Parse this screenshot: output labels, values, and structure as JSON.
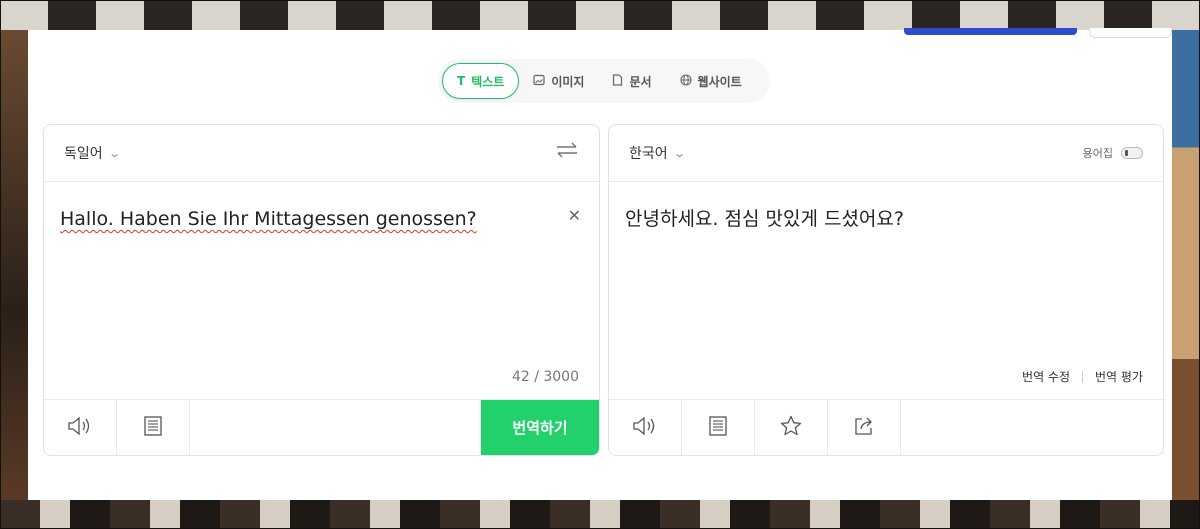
{
  "tabs": [
    {
      "label": "텍스트",
      "icon": "text-icon",
      "active": true
    },
    {
      "label": "이미지",
      "icon": "image-icon",
      "active": false
    },
    {
      "label": "문서",
      "icon": "document-icon",
      "active": false
    },
    {
      "label": "웹사이트",
      "icon": "globe-icon",
      "active": false
    }
  ],
  "source": {
    "language": "독일어",
    "text": "Hallo. Haben Sie Ihr Mittagessen genossen?",
    "char_count": "42 / 3000"
  },
  "target": {
    "language": "한국어",
    "glossary_label": "용어집",
    "text": "안녕하세요. 점심 맛있게 드셨어요?",
    "edit_label": "번역 수정",
    "rate_label": "번역 평가"
  },
  "translate_button": "번역하기",
  "colors": {
    "accent": "#22d06c",
    "active_tab": "#1ec265",
    "top_button": "#2e4bd1"
  }
}
